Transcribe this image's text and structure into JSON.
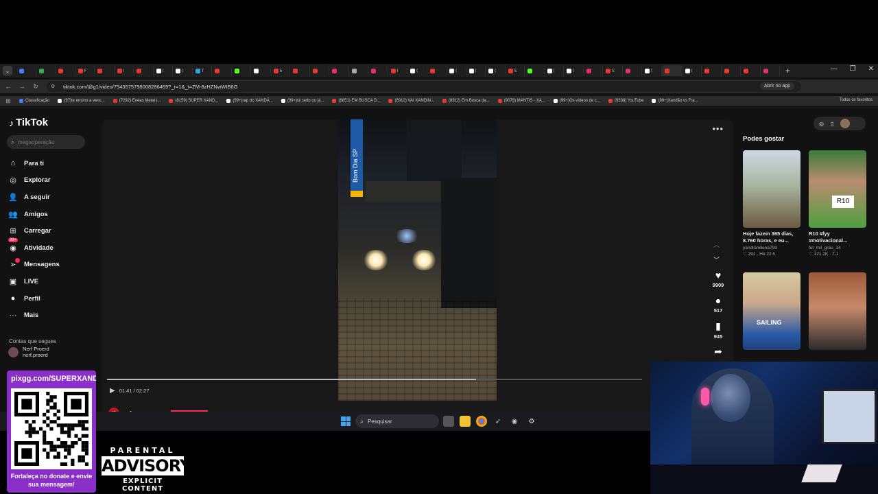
{
  "browser": {
    "url": "tiktok.com/@g1/video/7543575798008286469?_r=1&_t=ZM-8zHZNwWIB6G",
    "open_in_app": "Abrir no app",
    "tabs": [
      {
        "label": "",
        "color": "#4a7bf7"
      },
      {
        "label": "",
        "color": "#35a853"
      },
      {
        "label": "",
        "color": "#e53935"
      },
      {
        "label": "F",
        "color": "#e53935"
      },
      {
        "label": "",
        "color": "#e53935"
      },
      {
        "label": "I",
        "color": "#e53935"
      },
      {
        "label": "",
        "color": "#e53935"
      },
      {
        "label": "(",
        "color": "#ffffff"
      },
      {
        "label": "(",
        "color": "#ffffff"
      },
      {
        "label": "T",
        "color": "#2aa3e0"
      },
      {
        "label": "",
        "color": "#e53935"
      },
      {
        "label": "",
        "color": "#53fc18"
      },
      {
        "label": "",
        "color": "#ffffff"
      },
      {
        "label": "S",
        "color": "#e53935"
      },
      {
        "label": "",
        "color": "#e53935"
      },
      {
        "label": "",
        "color": "#e53935"
      },
      {
        "label": "",
        "color": "#e1306c"
      },
      {
        "label": "",
        "color": "#aaaaaa"
      },
      {
        "label": "",
        "color": "#e1306c"
      },
      {
        "label": "I",
        "color": "#e53935"
      },
      {
        "label": "(",
        "color": "#ffffff"
      },
      {
        "label": "",
        "color": "#e53935"
      },
      {
        "label": "(",
        "color": "#ffffff"
      },
      {
        "label": "(",
        "color": "#ffffff"
      },
      {
        "label": "(",
        "color": "#ffffff"
      },
      {
        "label": "S",
        "color": "#e53935"
      },
      {
        "label": "",
        "color": "#53fc18"
      },
      {
        "label": "(",
        "color": "#ffffff"
      },
      {
        "label": "(",
        "color": "#ffffff"
      },
      {
        "label": "",
        "color": "#e1306c"
      },
      {
        "label": "S",
        "color": "#e53935"
      },
      {
        "label": "",
        "color": "#e1306c"
      },
      {
        "label": "(",
        "color": "#ffffff"
      },
      {
        "label": "",
        "color": "#e53935"
      },
      {
        "label": "(",
        "color": "#ffffff"
      },
      {
        "label": "",
        "color": "#e53935"
      },
      {
        "label": "",
        "color": "#e53935"
      },
      {
        "label": "",
        "color": "#e53935"
      },
      {
        "label": "",
        "color": "#e1306c"
      }
    ],
    "bookmarks": [
      {
        "label": "Classificação",
        "color": "#4a7bf7"
      },
      {
        "label": "(97)te ensino a venc...",
        "color": "#ffffff"
      },
      {
        "label": "(7292) Enéas Metal |...",
        "color": "#e53935"
      },
      {
        "label": "(8159) SUPER XAND...",
        "color": "#e53935"
      },
      {
        "label": "(99+)rap do XANDÃ...",
        "color": "#ffffff"
      },
      {
        "label": "(99+)tá cedo ou já...",
        "color": "#ffffff"
      },
      {
        "label": "(8851) EM BUSCA D...",
        "color": "#e53935"
      },
      {
        "label": "(8912) VAI XANDIN...",
        "color": "#e53935"
      },
      {
        "label": "(8912) Em Busca da...",
        "color": "#e53935"
      },
      {
        "label": "(9078) MANTIS - XA...",
        "color": "#e53935"
      },
      {
        "label": "(99+)Os vídeos de c...",
        "color": "#ffffff"
      },
      {
        "label": "(9338) YouTube",
        "color": "#e53935"
      },
      {
        "label": "(99+)Xandão vs Fra...",
        "color": "#ffffff"
      }
    ],
    "all_bookmarks": "Todos os favoritos"
  },
  "tiktok": {
    "logo": "TikTok",
    "search_placeholder": "megaoperação",
    "nav": [
      {
        "label": "Para ti",
        "icon": "home-icon",
        "glyph": "⌂"
      },
      {
        "label": "Explorar",
        "icon": "compass-icon",
        "glyph": "◎"
      },
      {
        "label": "A seguir",
        "icon": "following-icon",
        "glyph": "👤"
      },
      {
        "label": "Amigos",
        "icon": "friends-icon",
        "glyph": "👥"
      },
      {
        "label": "Carregar",
        "icon": "upload-icon",
        "glyph": "⊞"
      },
      {
        "label": "Atividade",
        "icon": "activity-icon",
        "glyph": "◉"
      },
      {
        "label": "Mensagens",
        "icon": "messages-icon",
        "glyph": "➢"
      },
      {
        "label": "LIVE",
        "icon": "live-icon",
        "glyph": "▣"
      },
      {
        "label": "Perfil",
        "icon": "profile-icon",
        "glyph": "●"
      },
      {
        "label": "Mais",
        "icon": "more-icon",
        "glyph": "···"
      }
    ],
    "activity_badge": "99+",
    "following_title": "Contas que segues",
    "following_user": {
      "name": "Nerf Proerd",
      "handle": "nerf.proerd"
    },
    "video": {
      "watermark": "Bom Dia SP",
      "likes": "9909",
      "comments": "517",
      "saves": "945",
      "time": "01:41 / 02:27",
      "progress": 0.69,
      "author": "g1"
    },
    "suggest_title": "Podes gostar",
    "recommended": [
      {
        "title": "Hoje fazem 365 dias, 8.760 horas, e eu...",
        "user": "yandramilena799",
        "likes": "291",
        "age": "Há 22 h"
      },
      {
        "title": "R10 #fyy #motivacional...",
        "user": "fut_mil_grau_14",
        "likes": "121.2K",
        "age": "7-1",
        "thumb_text": "R10"
      },
      {
        "title": "",
        "user": "",
        "likes": "",
        "age": "",
        "thumb_text": "SAILING"
      },
      {
        "title": "",
        "user": "",
        "likes": "",
        "age": ""
      }
    ]
  },
  "taskbar": {
    "search_label": "Pesquisar"
  },
  "overlay": {
    "qr_url": "pixgg.com/SUPERXANDÃO",
    "qr_caption": "Fortaleça no donate e envie sua mensagem!",
    "parental_line1": "PARENTAL",
    "parental_line2": "ADVISORY",
    "parental_line3": "EXPLICIT CONTENT"
  }
}
